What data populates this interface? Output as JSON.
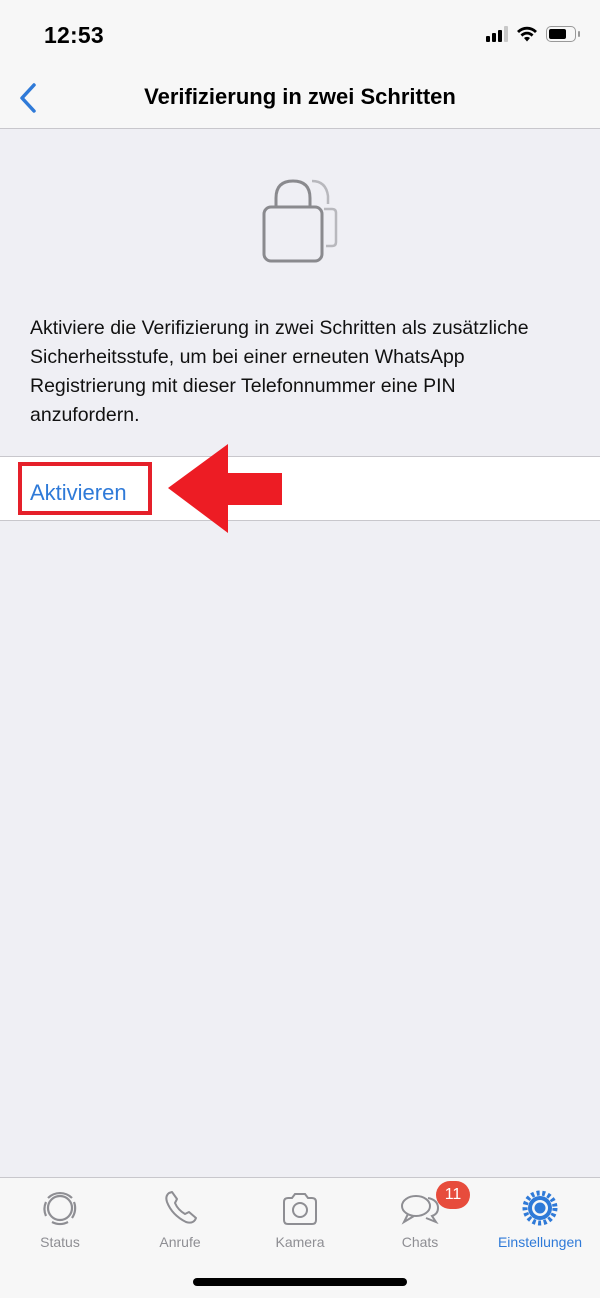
{
  "status_bar": {
    "time": "12:53",
    "signal_bars_filled": 3,
    "signal_bars_total": 4,
    "battery_level": 0.72
  },
  "nav": {
    "title": "Verifizierung in zwei Schritten",
    "back_icon": "chevron-left-icon"
  },
  "content": {
    "icon": "lock-stack-icon",
    "description": "Aktiviere die Verifizierung in zwei Schritten als zusätzliche Sicherheitsstufe, um bei einer erneuten WhatsApp Registrierung mit dieser Telefonnummer eine PIN anzufordern.",
    "activate_label": "Aktivieren"
  },
  "annotation": {
    "highlight_color": "#e5202a",
    "arrow_color": "#ed1c24"
  },
  "tab_bar": {
    "tabs": [
      {
        "label": "Status",
        "icon": "status-icon",
        "active": false
      },
      {
        "label": "Anrufe",
        "icon": "phone-icon",
        "active": false
      },
      {
        "label": "Kamera",
        "icon": "camera-icon",
        "active": false
      },
      {
        "label": "Chats",
        "icon": "chat-bubbles-icon",
        "active": false,
        "badge": "11"
      },
      {
        "label": "Einstellungen",
        "icon": "gear-icon",
        "active": true
      }
    ]
  },
  "colors": {
    "accent": "#2f7ad8",
    "inactive": "#8e8e93",
    "badge": "#e74c3c",
    "background": "#efeff4"
  }
}
